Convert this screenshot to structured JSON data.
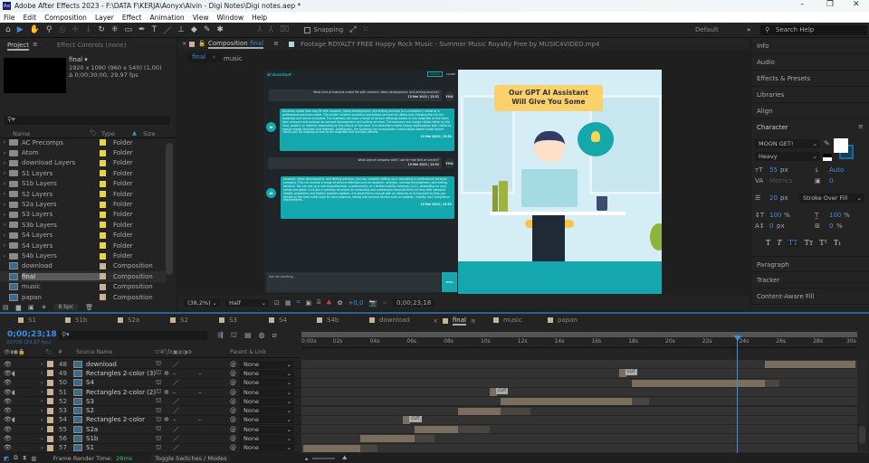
{
  "window": {
    "title": "Adobe After Effects 2023 - F:\\DATA F\\KERJA\\Aonyx\\Alvin - Digi Notes\\Digi notes.aep *",
    "logo": "Ae"
  },
  "menu": [
    "File",
    "Edit",
    "Composition",
    "Layer",
    "Effect",
    "Animation",
    "View",
    "Window",
    "Help"
  ],
  "toolbar": {
    "snapping": "Snapping",
    "workspace": "Default",
    "search_placeholder": "Search Help"
  },
  "project": {
    "tab": "Project",
    "effect_tab": "Effect Controls (none)",
    "comp_name": "final ▾",
    "comp_info1": "1920 x 1080  (960 x 540) (1,00)",
    "comp_info2": "Δ 0;00;30;00, 29,97 fps",
    "columns": {
      "name": "Name",
      "type": "Type",
      "size": "Size"
    },
    "items": [
      {
        "name": "AC Precomps",
        "type": "Folder",
        "kind": "folder"
      },
      {
        "name": "Atom",
        "type": "Folder",
        "kind": "folder"
      },
      {
        "name": "download Layers",
        "type": "Folder",
        "kind": "folder"
      },
      {
        "name": "S1 Layers",
        "type": "Folder",
        "kind": "folder"
      },
      {
        "name": "S1b Layers",
        "type": "Folder",
        "kind": "folder"
      },
      {
        "name": "S2 Layers",
        "type": "Folder",
        "kind": "folder"
      },
      {
        "name": "S2a Layers",
        "type": "Folder",
        "kind": "folder"
      },
      {
        "name": "S3 Layers",
        "type": "Folder",
        "kind": "folder"
      },
      {
        "name": "S3b Layers",
        "type": "Folder",
        "kind": "folder"
      },
      {
        "name": "S4 Layers",
        "type": "Folder",
        "kind": "folder"
      },
      {
        "name": "S4 Layers",
        "type": "Folder",
        "kind": "folder"
      },
      {
        "name": "S4b Layers",
        "type": "Folder",
        "kind": "folder"
      },
      {
        "name": "download",
        "type": "Composition",
        "kind": "comp"
      },
      {
        "name": "final",
        "type": "Composition",
        "kind": "comp",
        "selected": true
      },
      {
        "name": "music",
        "type": "Composition",
        "kind": "comp"
      },
      {
        "name": "papan",
        "type": "Composition",
        "kind": "comp"
      }
    ],
    "bpc": "8 bpc"
  },
  "viewer": {
    "comp_tab_prefix": "Composition",
    "comp_tab_name": "final",
    "footage_tab": "Footage  ROYALTY FREE Happy Rock Music - Summer Music Royalty Free by MUSIC4VIDEO.mp4",
    "crumb_active": "final",
    "crumb_next": "music",
    "zoom": "(38,2%)",
    "resolution": "Half",
    "exposure": "+0,0",
    "timecode": "0;00;23;18"
  },
  "chat": {
    "title": "AI Assistant",
    "topics": "TOPICS",
    "close": "CLOSE",
    "you": "YOU",
    "ai": "AI",
    "messages": [
      {
        "text": "What kind of business model fits with research, ideas development, and writing services?",
        "time": "15 Mei 2023 | 15:51"
      },
      {
        "text": "Business model that may fit with research, ideas development, and writing services is a consultancy model or a professional services model. This model involves providing specialized services to clients and charging fees for the expertise and advice provided. The business can have a range of service offerings based on the expertise of the team, from research and analysis to concept development and writing services. The business can charge clients either by the hour, project, or retainer, depending on the nature of the work. It is essential to build strong relationships with clients to ensure repeat business and referrals. Additionally, the business can incorporate a subscription-based model where clients pay for ongoing access to the expertise and services offered.",
        "time": "15 Mei 2023 | 15:51"
      },
      {
        "text": "What type of company shall I use for that kind of service?",
        "time": "15 Mei 2023 | 15:52"
      },
      {
        "text": "research, ideas development, and writing services, you can consider setting up a consulting or professional services company. This can include a range of service offerings such as research, analysis, concept development, and writing services. You can set up a sole proprietorship, a partnership, or a limited liability company (LLC), depending on your needs and goals. LLCs are a common structure for consulting and professional services firms as they offer personal liability protection and flexible taxation options. It is essential to consult with an attorney or accountant to help you decide on the best entity type for your business, taking into account factors such as taxation, liability, and compliance requirements.",
        "time": "15 Mei 2023 | 15:52"
      }
    ],
    "input_placeholder": "Ask me anything",
    "send": "SEND"
  },
  "scene": {
    "headline1": "Our GPT AI Assistant",
    "headline2": "Will Give You Some"
  },
  "right": {
    "panels_top": [
      "Info",
      "Audio",
      "Effects & Presets",
      "Libraries",
      "Align"
    ],
    "character": "Character",
    "panels_bottom": [
      "Paragraph",
      "Tracker",
      "Content-Aware Fill"
    ],
    "font": "MOON GET!",
    "style": "Heavy",
    "size": "55",
    "size_unit": "px",
    "leading": "Auto",
    "kerning": "Metrics",
    "tracking": "0",
    "stroke": "20",
    "stroke_unit": "px",
    "stroke_mode": "Stroke Over Fill",
    "vscale": "100",
    "hscale": "100",
    "pct": "%",
    "baseline": "0",
    "baseline_unit": "px",
    "tsume": "0",
    "tsume_unit": "%",
    "styles": [
      "T",
      "T",
      "TT",
      "Tт",
      "T¹",
      "T₁"
    ]
  },
  "timeline": {
    "tabs": [
      "S1",
      "S1b",
      "S2a",
      "S2",
      "S3",
      "S4",
      "S4b",
      "download",
      "final",
      "music",
      "papan"
    ],
    "active_tab": "final",
    "timecode": "0;00;23;18",
    "frame_info": "00708 (29.97 fps)",
    "columns": {
      "num": "#",
      "source": "Source Name",
      "parent": "Parent & Link"
    },
    "ruler": [
      "0:00s",
      "02s",
      "04s",
      "06s",
      "08s",
      "10s",
      "12s",
      "14s",
      "16s",
      "18s",
      "20s",
      "22s",
      "24s",
      "26s",
      "28s",
      "30s"
    ],
    "duration_s": 30,
    "current_time_s": 23.6,
    "layers": [
      {
        "num": "48",
        "name": "download",
        "audio": false,
        "kind": "comp",
        "parent": "None",
        "bar": [
          25.1,
          30
        ],
        "tail": null,
        "cut": null
      },
      {
        "num": "49",
        "name": "Rectangles 2-color (3)",
        "audio": true,
        "kind": "shape",
        "parent": "None",
        "bar": null,
        "tail": null,
        "cut": 17.5
      },
      {
        "num": "50",
        "name": "S4",
        "audio": false,
        "kind": "comp",
        "parent": "None",
        "bar": [
          17.9,
          25.1
        ],
        "tail": 25.9,
        "cut": null
      },
      {
        "num": "51",
        "name": "Rectangles 2-color (2)",
        "audio": true,
        "kind": "shape",
        "parent": "None",
        "bar": null,
        "tail": null,
        "cut": 10.5
      },
      {
        "num": "52",
        "name": "S3",
        "audio": false,
        "kind": "comp",
        "parent": "None",
        "bar": [
          10.8,
          17.9
        ],
        "tail": 18.8,
        "cut": null
      },
      {
        "num": "53",
        "name": "S2",
        "audio": false,
        "kind": "comp",
        "parent": "None",
        "bar": [
          8.5,
          10.8
        ],
        "tail": 12.4,
        "cut": null
      },
      {
        "num": "54",
        "name": "Rectangles 2-color",
        "audio": true,
        "kind": "shape",
        "parent": "None",
        "bar": null,
        "tail": null,
        "cut": 5.8
      },
      {
        "num": "55",
        "name": "S2a",
        "audio": false,
        "kind": "comp",
        "parent": "None",
        "bar": [
          6.15,
          8.5
        ],
        "tail": 10.2,
        "cut": null
      },
      {
        "num": "56",
        "name": "S1b",
        "audio": false,
        "kind": "comp",
        "parent": "None",
        "bar": [
          3.2,
          6.15
        ],
        "tail": 7.2,
        "cut": null
      },
      {
        "num": "57",
        "name": "S1",
        "audio": false,
        "kind": "comp",
        "parent": "None",
        "bar": [
          0.1,
          3.2
        ],
        "tail": 4.1,
        "cut": null
      }
    ],
    "cut_label": "CUT",
    "footer": {
      "render_label": "Frame Render Time:",
      "render_value": "28ms",
      "toggle": "Toggle Switches / Modes"
    }
  },
  "colors": {
    "accent": "#3b8ee0",
    "chat_teal": "#13a8ad",
    "bar": "#7a6f5f",
    "folder_label": "#e8d44a",
    "comp_label": "#c8b392"
  }
}
